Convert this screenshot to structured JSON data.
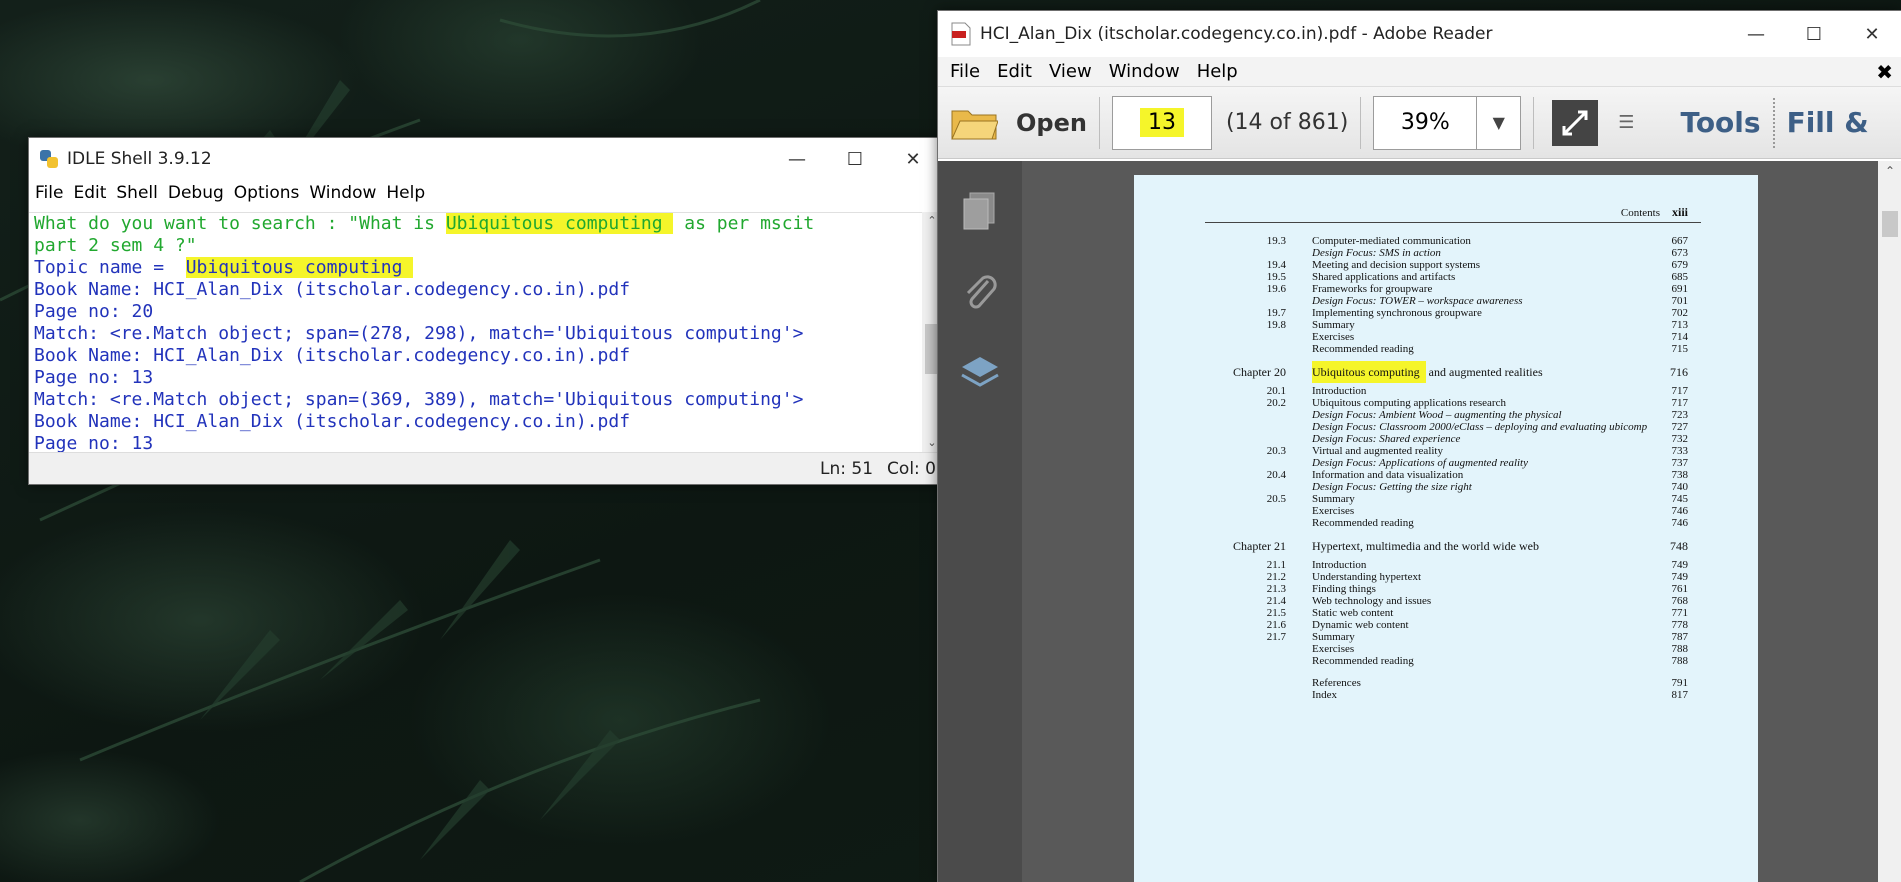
{
  "idle": {
    "title": "IDLE Shell 3.9.12",
    "menu": [
      "File",
      "Edit",
      "Shell",
      "Debug",
      "Options",
      "Window",
      "Help"
    ],
    "shell": {
      "l1_pre": "What do you want to search : \"What is ",
      "l1_hl": "Ubiquitous computing ",
      "l1_post": " as per mscit",
      "l2": "part 2 sem 4 ?\"",
      "l3_pre": "Topic name =  ",
      "l3_hl": "Ubiquitous computing ",
      "l4": "Book Name: HCI_Alan_Dix (itscholar.codegency.co.in).pdf",
      "l5": "Page no: 20",
      "l6": "Match: <re.Match object; span=(278, 298), match='Ubiquitous computing'>",
      "l7": "Book Name: HCI_Alan_Dix (itscholar.codegency.co.in).pdf",
      "l8": "Page no: 13",
      "l9": "Match: <re.Match object; span=(369, 389), match='Ubiquitous computing'>",
      "l10": "Book Name: HCI_Alan_Dix (itscholar.codegency.co.in).pdf",
      "l11": "Page no: 13"
    },
    "status_ln": "Ln: 51",
    "status_col": "Col: 0"
  },
  "reader": {
    "title": "HCI_Alan_Dix (itscholar.codegency.co.in).pdf - Adobe Reader",
    "menu": [
      "File",
      "Edit",
      "View",
      "Window",
      "Help"
    ],
    "toolbar": {
      "open_label": "Open",
      "page_value": "13",
      "page_of": "(14 of 861)",
      "zoom_value": "39%",
      "tools_label": "Tools",
      "fill_label": "Fill &"
    },
    "page": {
      "header_label": "Contents",
      "header_page": "xiii",
      "rows": [
        {
          "num": "19.3",
          "title": "Computer-mediated communication",
          "page": "667",
          "style": "n"
        },
        {
          "num": "",
          "title": "Design Focus: SMS in action",
          "page": "673",
          "style": "it"
        },
        {
          "num": "19.4",
          "title": "Meeting and decision support systems",
          "page": "679",
          "style": "n"
        },
        {
          "num": "19.5",
          "title": "Shared applications and artifacts",
          "page": "685",
          "style": "n"
        },
        {
          "num": "19.6",
          "title": "Frameworks for groupware",
          "page": "691",
          "style": "n"
        },
        {
          "num": "",
          "title": "Design Focus: TOWER – workspace awareness",
          "page": "701",
          "style": "it"
        },
        {
          "num": "19.7",
          "title": "Implementing synchronous groupware",
          "page": "702",
          "style": "n"
        },
        {
          "num": "19.8",
          "title": "Summary",
          "page": "713",
          "style": "n"
        },
        {
          "num": "",
          "title": "Exercises",
          "page": "714",
          "style": "n"
        },
        {
          "num": "",
          "title": "Recommended reading",
          "page": "715",
          "style": "n"
        },
        {
          "num": "Chapter 20",
          "title": "Ubiquitous computing and augmented realities",
          "page": "716",
          "style": "chap"
        },
        {
          "num": "20.1",
          "title": "Introduction",
          "page": "717",
          "style": "n"
        },
        {
          "num": "20.2",
          "title": "Ubiquitous computing applications research",
          "page": "717",
          "style": "n"
        },
        {
          "num": "",
          "title": "Design Focus: Ambient Wood – augmenting the physical",
          "page": "723",
          "style": "it"
        },
        {
          "num": "",
          "title": "Design Focus: Classroom 2000/eClass – deploying and evaluating ubicomp",
          "page": "727",
          "style": "it"
        },
        {
          "num": "",
          "title": "Design Focus: Shared experience",
          "page": "732",
          "style": "it"
        },
        {
          "num": "20.3",
          "title": "Virtual and augmented reality",
          "page": "733",
          "style": "n"
        },
        {
          "num": "",
          "title": "Design Focus: Applications of augmented reality",
          "page": "737",
          "style": "it"
        },
        {
          "num": "20.4",
          "title": "Information and data visualization",
          "page": "738",
          "style": "n"
        },
        {
          "num": "",
          "title": "Design Focus: Getting the size right",
          "page": "740",
          "style": "it"
        },
        {
          "num": "20.5",
          "title": "Summary",
          "page": "745",
          "style": "n"
        },
        {
          "num": "",
          "title": "Exercises",
          "page": "746",
          "style": "n"
        },
        {
          "num": "",
          "title": "Recommended reading",
          "page": "746",
          "style": "n"
        },
        {
          "num": "Chapter 21",
          "title": "Hypertext, multimedia and the world wide web",
          "page": "748",
          "style": "chap"
        },
        {
          "num": "21.1",
          "title": "Introduction",
          "page": "749",
          "style": "n"
        },
        {
          "num": "21.2",
          "title": "Understanding hypertext",
          "page": "749",
          "style": "n"
        },
        {
          "num": "21.3",
          "title": "Finding things",
          "page": "761",
          "style": "n"
        },
        {
          "num": "21.4",
          "title": "Web technology and issues",
          "page": "768",
          "style": "n"
        },
        {
          "num": "21.5",
          "title": "Static web content",
          "page": "771",
          "style": "n"
        },
        {
          "num": "21.6",
          "title": "Dynamic web content",
          "page": "778",
          "style": "n"
        },
        {
          "num": "21.7",
          "title": "Summary",
          "page": "787",
          "style": "n"
        },
        {
          "num": "",
          "title": "Exercises",
          "page": "788",
          "style": "n"
        },
        {
          "num": "",
          "title": "Recommended reading",
          "page": "788",
          "style": "n"
        },
        {
          "num": "",
          "title": "References",
          "page": "791",
          "style": "n"
        },
        {
          "num": "",
          "title": "Index",
          "page": "817",
          "style": "n"
        }
      ]
    }
  },
  "colors": {
    "highlight": "#f5f52a",
    "shell_green": "#21a82f",
    "shell_blue": "#2233bb",
    "reader_accent": "#3d5f86",
    "page_bg": "#e3f4fb"
  }
}
